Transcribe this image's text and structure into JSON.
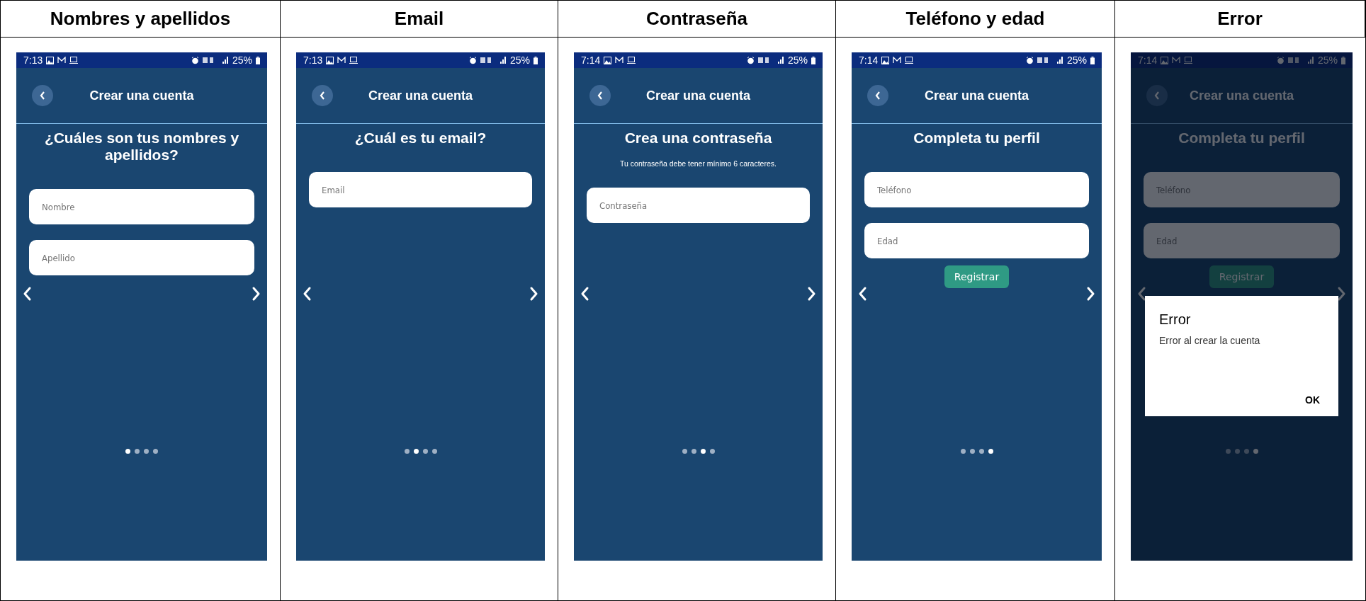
{
  "table": {
    "columns": [
      "Nombres y apellidos",
      "Email",
      "Contraseña",
      "Teléfono y edad",
      "Error"
    ]
  },
  "screens": [
    {
      "time": "7:13",
      "battery": "25%",
      "title": "Crear una cuenta",
      "heading": "¿Cuáles son tus nombres y apellidos?",
      "fields": [
        {
          "placeholder": "Nombre"
        },
        {
          "placeholder": "Apellido"
        }
      ],
      "page_dots": [
        {
          "selected": true
        },
        {
          "selected": false
        },
        {
          "selected": false
        },
        {
          "selected": false
        }
      ]
    },
    {
      "time": "7:13",
      "battery": "25%",
      "title": "Crear una cuenta",
      "heading": "¿Cuál es tu email?",
      "fields": [
        {
          "placeholder": "Email"
        }
      ],
      "page_dots": [
        {
          "selected": false
        },
        {
          "selected": true
        },
        {
          "selected": false
        },
        {
          "selected": false
        }
      ]
    },
    {
      "time": "7:14",
      "battery": "25%",
      "title": "Crear una cuenta",
      "heading": "Crea una contraseña",
      "note": "Tu contraseña debe tener mínimo 6 caracteres.",
      "fields": [
        {
          "placeholder": "Contraseña"
        }
      ],
      "page_dots": [
        {
          "selected": false
        },
        {
          "selected": false
        },
        {
          "selected": true
        },
        {
          "selected": false
        }
      ]
    },
    {
      "time": "7:14",
      "battery": "25%",
      "title": "Crear una cuenta",
      "heading": "Completa tu perfil",
      "fields": [
        {
          "placeholder": "Teléfono"
        },
        {
          "placeholder": "Edad"
        }
      ],
      "button": "Registrar",
      "page_dots": [
        {
          "selected": false
        },
        {
          "selected": false
        },
        {
          "selected": false
        },
        {
          "selected": true
        }
      ]
    },
    {
      "time": "7:14",
      "battery": "25%",
      "title": "Crear una cuenta",
      "heading": "Completa tu perfil",
      "fields": [
        {
          "placeholder": "Teléfono"
        },
        {
          "placeholder": "Edad"
        }
      ],
      "button": "Registrar",
      "page_dots": [
        {
          "selected": false
        },
        {
          "selected": false
        },
        {
          "selected": false
        },
        {
          "selected": true
        }
      ],
      "dialog": {
        "title": "Error",
        "message": "Error al crear la cuenta",
        "button": "OK"
      }
    }
  ]
}
